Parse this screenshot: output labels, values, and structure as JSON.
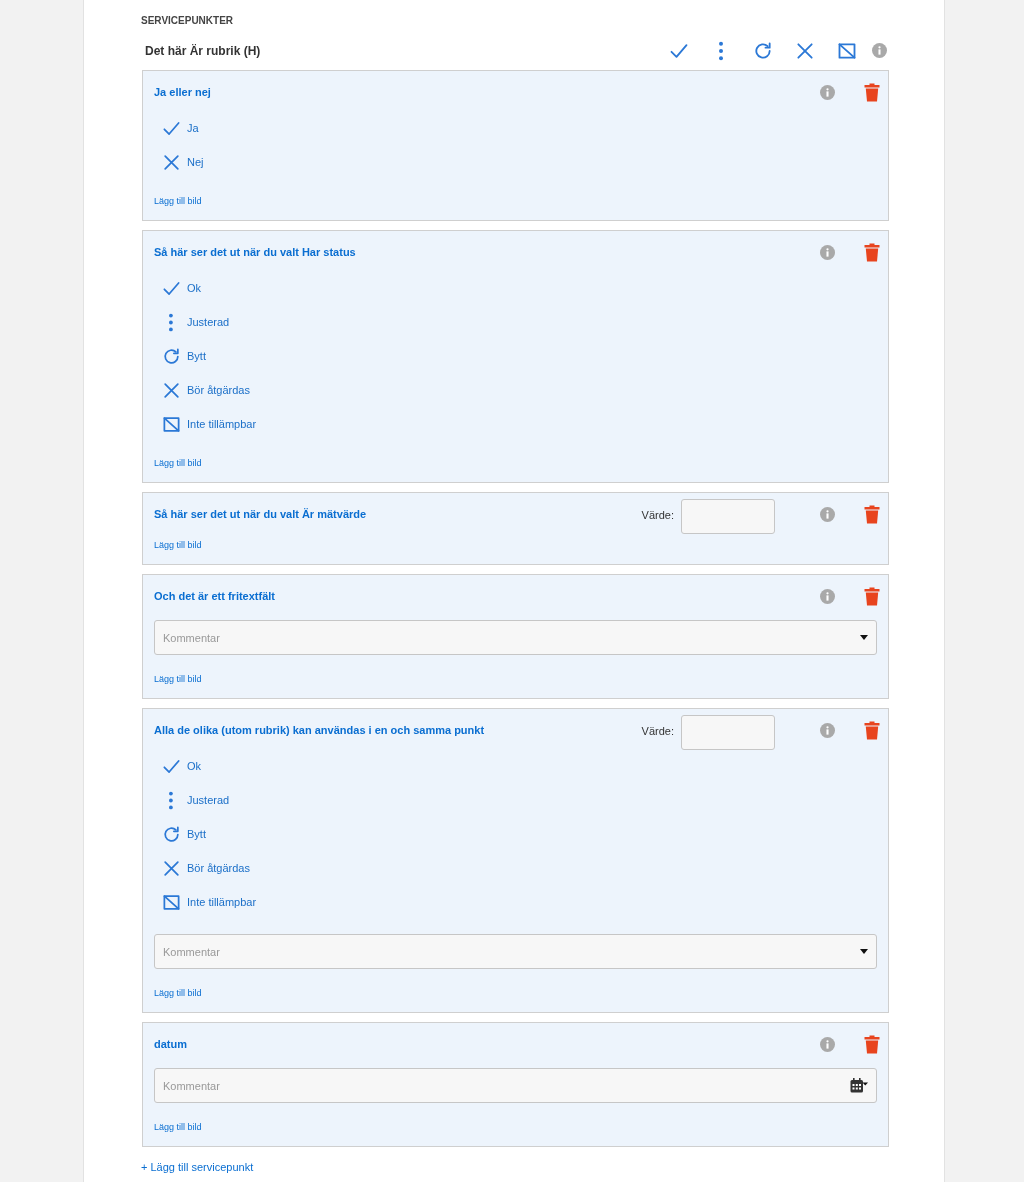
{
  "section_title": "SERVICEPUNKTER",
  "header": {
    "title": "Det här Är rubrik (H)",
    "status_icons": [
      {
        "kind": "check"
      },
      {
        "kind": "dots"
      },
      {
        "kind": "refresh"
      },
      {
        "kind": "cross"
      },
      {
        "kind": "na"
      }
    ]
  },
  "items": [
    {
      "title": "Ja eller nej",
      "options": [
        {
          "kind": "check",
          "label": "Ja"
        },
        {
          "kind": "cross",
          "label": "Nej"
        }
      ],
      "add_image": "Lägg till bild"
    },
    {
      "title": "Så här ser det ut när du valt Har status",
      "options": [
        {
          "kind": "check",
          "label": "Ok"
        },
        {
          "kind": "dots",
          "label": "Justerad"
        },
        {
          "kind": "refresh",
          "label": "Bytt"
        },
        {
          "kind": "cross",
          "label": "Bör åtgärdas"
        },
        {
          "kind": "na",
          "label": "Inte tillämpbar"
        }
      ],
      "add_image": "Lägg till bild"
    },
    {
      "title": "Så här ser det ut när du valt Är mätvärde",
      "value_label": "Värde:",
      "add_image": "Lägg till bild"
    },
    {
      "title": "Och det är ett fritextfält",
      "comment": {
        "kind": "dropdown",
        "placeholder": "Kommentar"
      },
      "add_image": "Lägg till bild"
    },
    {
      "title": "Alla de olika (utom rubrik) kan användas i en och samma punkt",
      "value_label": "Värde:",
      "options": [
        {
          "kind": "check",
          "label": "Ok"
        },
        {
          "kind": "dots",
          "label": "Justerad"
        },
        {
          "kind": "refresh",
          "label": "Bytt"
        },
        {
          "kind": "cross",
          "label": "Bör åtgärdas"
        },
        {
          "kind": "na",
          "label": "Inte tillämpbar"
        }
      ],
      "comment": {
        "kind": "dropdown",
        "placeholder": "Kommentar"
      },
      "add_image": "Lägg till bild"
    },
    {
      "title": "datum",
      "comment": {
        "kind": "date",
        "placeholder": "Kommentar"
      },
      "add_image": "Lägg till bild"
    }
  ],
  "add_point": "+ Lägg till servicepunkt"
}
